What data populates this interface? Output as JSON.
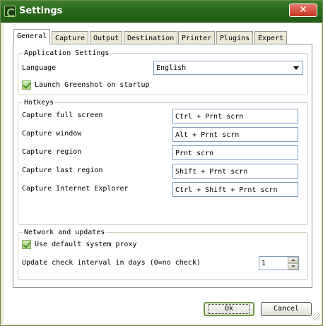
{
  "window": {
    "title": "Settings",
    "close_label": "✕"
  },
  "tabs": [
    {
      "label": "General",
      "active": true
    },
    {
      "label": "Capture"
    },
    {
      "label": "Output"
    },
    {
      "label": "Destination"
    },
    {
      "label": "Printer"
    },
    {
      "label": "Plugins"
    },
    {
      "label": "Expert"
    }
  ],
  "application_settings": {
    "legend": "Application Settings",
    "language_label": "Language",
    "language_value": "English",
    "launch_on_startup_label": "Launch Greenshot on startup",
    "launch_on_startup_checked": true
  },
  "hotkeys": {
    "legend": "Hotkeys",
    "items": [
      {
        "label": "Capture full screen",
        "value": "Ctrl + Prnt scrn"
      },
      {
        "label": "Capture window",
        "value": "Alt + Prnt scrn"
      },
      {
        "label": "Capture region",
        "value": "Prnt scrn"
      },
      {
        "label": "Capture last region",
        "value": "Shift + Prnt scrn"
      },
      {
        "label": "Capture Internet Explorer",
        "value": "Ctrl + Shift + Prnt scrn"
      }
    ]
  },
  "network": {
    "legend": "Network and updates",
    "proxy_label": "Use default system proxy",
    "proxy_checked": true,
    "update_interval_label": "Update check interval in days (0=no check)",
    "update_interval_value": "1"
  },
  "buttons": {
    "ok": "Ok",
    "cancel": "Cancel"
  },
  "colors": {
    "title_bar": "#2a6a1c",
    "dialog_face": "#ece9d8",
    "check_fill": "#a9d37e"
  }
}
